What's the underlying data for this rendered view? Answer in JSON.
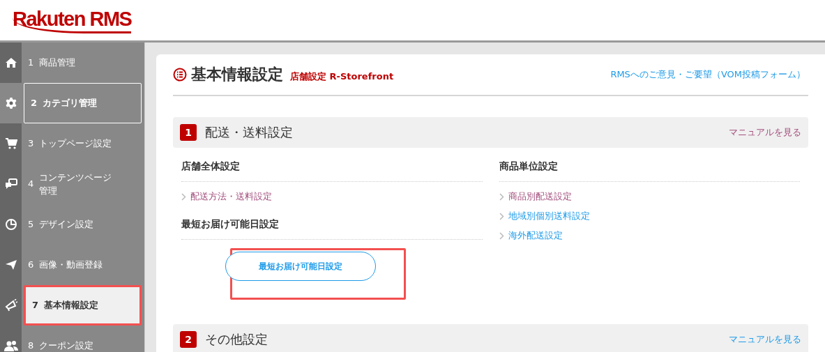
{
  "header": {
    "logo": "Rakuten RMS"
  },
  "sidebar": {
    "items": [
      {
        "number": "1",
        "label": "商品管理",
        "selected": false,
        "focused": false,
        "highlighted": false
      },
      {
        "number": "2",
        "label": "カテゴリ管理",
        "selected": false,
        "focused": true,
        "highlighted": false
      },
      {
        "number": "3",
        "label": "トップページ設定",
        "selected": false,
        "focused": false,
        "highlighted": false
      },
      {
        "number": "4",
        "label": "コンテンツページ管理",
        "selected": false,
        "focused": false,
        "highlighted": false
      },
      {
        "number": "5",
        "label": "デザイン設定",
        "selected": false,
        "focused": false,
        "highlighted": false
      },
      {
        "number": "6",
        "label": "画像・動画登録",
        "selected": false,
        "focused": false,
        "highlighted": false
      },
      {
        "number": "7",
        "label": "基本情報設定",
        "selected": true,
        "focused": false,
        "highlighted": true
      },
      {
        "number": "8",
        "label": "クーポン設定",
        "selected": false,
        "focused": false,
        "highlighted": false
      }
    ]
  },
  "page": {
    "title": "基本情報設定",
    "subtitle": "店舗設定 R-Storefront",
    "feedback_link": "RMSへのご意見・ご要望（VOM投稿フォーム）"
  },
  "sections": [
    {
      "number": "1",
      "title": "配送・送料設定",
      "manual_link": {
        "label": "マニュアルを見る",
        "visited": true
      },
      "columns": [
        {
          "groups": [
            {
              "heading": "店舗全体設定",
              "links": [
                {
                  "label": "配送方法・送料設定",
                  "visited": true
                }
              ]
            },
            {
              "heading": "最短お届け可能日設定",
              "button": {
                "label": "最短お届け可能日設定",
                "highlighted": true
              }
            }
          ]
        },
        {
          "groups": [
            {
              "heading": "商品単位設定",
              "links": [
                {
                  "label": "商品別配送設定",
                  "visited": true
                },
                {
                  "label": "地域別個別送料設定",
                  "visited": false
                },
                {
                  "label": "海外配送設定",
                  "visited": false
                }
              ]
            }
          ]
        }
      ]
    },
    {
      "number": "2",
      "title": "その他設定",
      "manual_link": {
        "label": "マニュアルを見る",
        "visited": false
      }
    }
  ]
}
